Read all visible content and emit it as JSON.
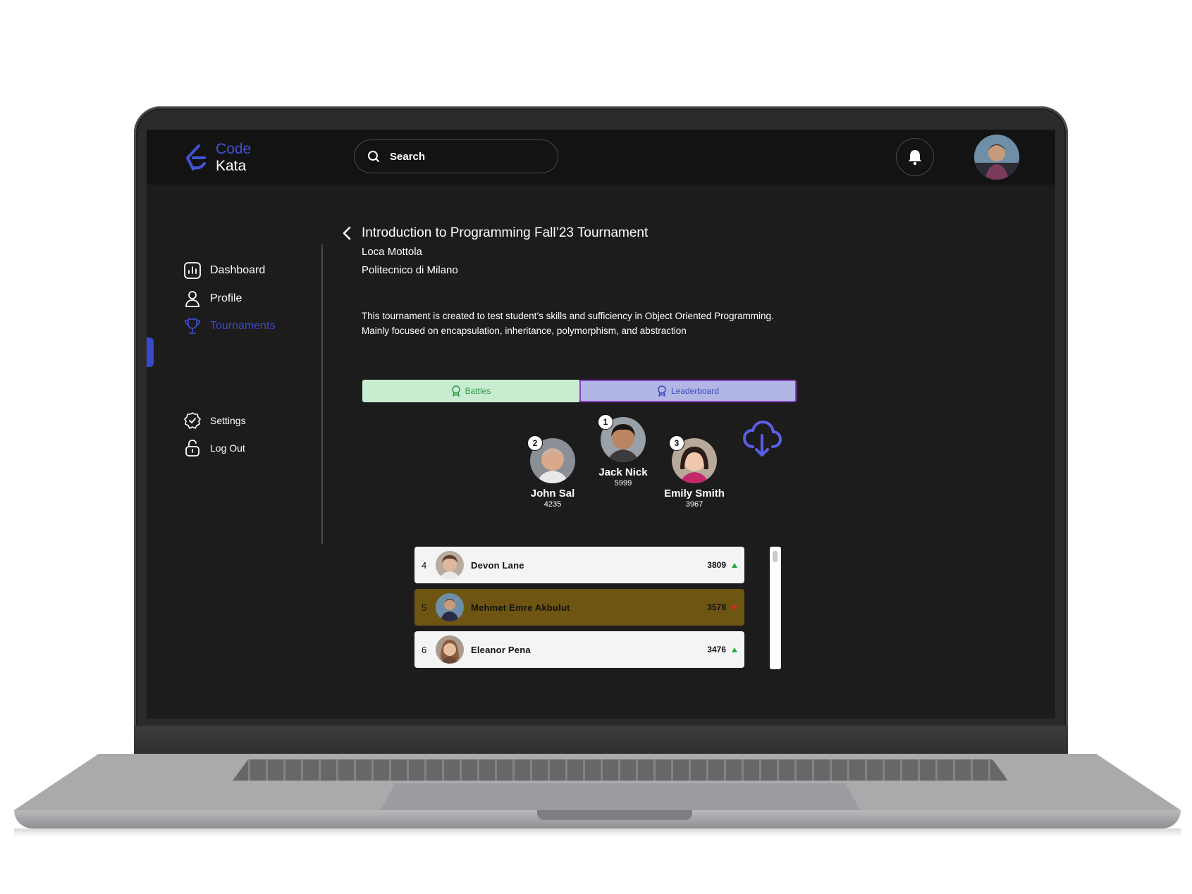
{
  "brand": {
    "name_line1": "Code",
    "name_line2": "Kata",
    "accent": "#4353d6"
  },
  "search": {
    "label": "Search"
  },
  "sidebar": {
    "items": [
      {
        "label": "Dashboard",
        "icon": "bar-chart-icon"
      },
      {
        "label": "Profile",
        "icon": "user-icon"
      },
      {
        "label": "Tournaments",
        "icon": "trophy-icon",
        "active": true
      }
    ],
    "bottom_items": [
      {
        "label": "Settings",
        "icon": "settings-badge-icon"
      },
      {
        "label": "Log Out",
        "icon": "unlock-icon"
      }
    ]
  },
  "tournament": {
    "title": "Introduction to Programming Fall’23 Tournament",
    "organizer": "Loca Mottola",
    "institution": "Politecnico di Milano",
    "description_line1": "This tournament is created to test student’s skills and sufficiency in Object Oriented Programming.",
    "description_line2": "Mainly focused on encapsulation, inheritance, polymorphism, and abstraction"
  },
  "tabs": {
    "battles": "Battles",
    "leaderboard": "Leaderboard"
  },
  "podium": [
    {
      "rank": "1",
      "name": "Jack Nick",
      "score": "5999"
    },
    {
      "rank": "2",
      "name": "John Sal",
      "score": "4235"
    },
    {
      "rank": "3",
      "name": "Emily Smith",
      "score": "3967"
    }
  ],
  "leaderboard": [
    {
      "rank": "4",
      "name": "Devon Lane",
      "score": "3809",
      "trend": "up"
    },
    {
      "rank": "5",
      "name": "Mehmet Emre Akbulut",
      "score": "3578",
      "trend": "down",
      "highlight": true
    },
    {
      "rank": "6",
      "name": "Eleanor Pena",
      "score": "3476",
      "trend": "up"
    }
  ],
  "colors": {
    "active_nav": "#3a49c9",
    "highlight_row": "#6e5612",
    "battles_tab": "#c8ecd0",
    "leaderboard_tab": "#b1b6e4"
  }
}
